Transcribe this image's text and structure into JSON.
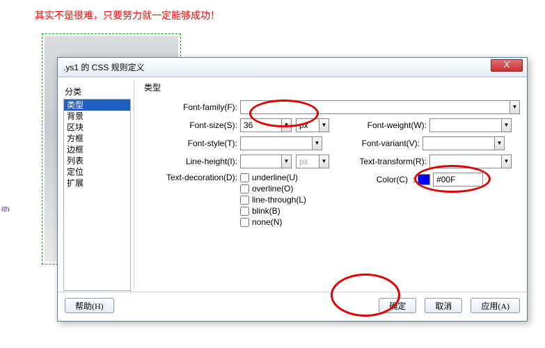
{
  "bg_text": "其实不是很难，只要努力就一定能够成功！",
  "bg_ith": "ith",
  "title": ".ys1 的 CSS 规则定义",
  "sidebar_title": "分类",
  "sidebar_items": [
    "类型",
    "背景",
    "区块",
    "方框",
    "边框",
    "列表",
    "定位",
    "扩展"
  ],
  "main_title": "类型",
  "labels": {
    "font_family": "Font-family(F):",
    "font_size": "Font-size(S):",
    "font_style": "Font-style(T):",
    "line_height": "Line-height(I):",
    "text_deco": "Text-decoration(D):",
    "font_weight": "Font-weight(W):",
    "font_variant": "Font-variant(V):",
    "text_transform": "Text-transform(R):",
    "color": "Color(C)"
  },
  "values": {
    "font_size": "36",
    "unit_px": "px",
    "color": "#00F"
  },
  "deco": {
    "underline": "underline(U)",
    "overline": "overline(O)",
    "linethrough": "line-through(L)",
    "blink": "blink(B)",
    "none": "none(N)"
  },
  "buttons": {
    "help": "帮助(H)",
    "ok": "确定",
    "cancel": "取消",
    "apply": "应用(A)"
  },
  "close": "X"
}
